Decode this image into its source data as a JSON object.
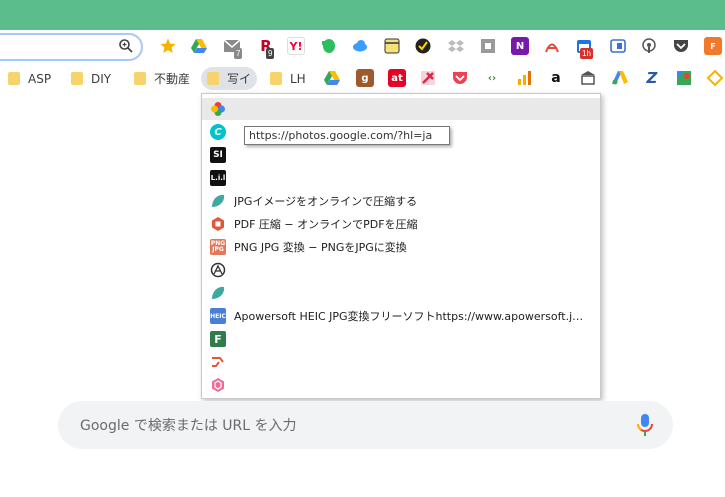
{
  "bookmarks_bar": {
    "folders": [
      {
        "label": "ASP"
      },
      {
        "label": "DIY"
      },
      {
        "label": "不動産"
      },
      {
        "label": "写イ"
      },
      {
        "label": "LH"
      }
    ]
  },
  "extensions": {
    "badges": [
      "7",
      "9",
      "1h"
    ]
  },
  "dropdown": {
    "items": [
      {
        "label": ""
      },
      {
        "label": ""
      },
      {
        "label": ""
      },
      {
        "label": ""
      },
      {
        "label": "JPGイメージをオンラインで圧縮する"
      },
      {
        "label": "PDF 圧縮 − オンラインでPDFを圧縮"
      },
      {
        "label": "PNG JPG 変換 − PNGをJPGに変換"
      },
      {
        "label": ""
      },
      {
        "label": ""
      },
      {
        "label": "Apowersoft HEIC JPG変換フリーソフトhttps://www.apowersoft.jp/heic-to-jpg"
      },
      {
        "label": ""
      },
      {
        "label": ""
      },
      {
        "label": ""
      }
    ]
  },
  "tooltip": {
    "text": "https://photos.google.com/?hl=ja"
  },
  "search": {
    "placeholder": "Google で検索または URL を入力"
  }
}
